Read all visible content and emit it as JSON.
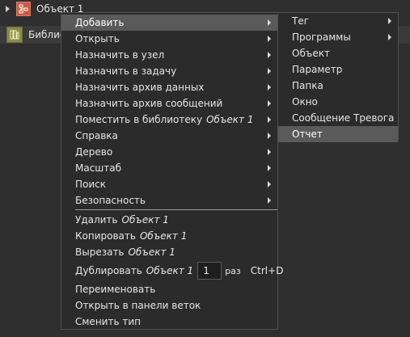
{
  "tree": {
    "object_label": "Объект 1",
    "library_label": "Библио"
  },
  "main_menu": {
    "items": [
      {
        "label": "Добавить"
      },
      {
        "label": "Открыть"
      },
      {
        "label": "Назначить в узел"
      },
      {
        "label": "Назначить в задачу"
      },
      {
        "label": "Назначить архив данных"
      },
      {
        "label": "Назначить архив сообщений"
      },
      {
        "label": "Поместить в библиотеку",
        "target": "Объект 1"
      },
      {
        "label": "Справка"
      },
      {
        "label": "Дерево"
      },
      {
        "label": "Масштаб"
      },
      {
        "label": "Поиск"
      },
      {
        "label": "Безопасность"
      }
    ],
    "actions": [
      {
        "label": "Удалить",
        "target": "Объект 1"
      },
      {
        "label": "Копировать",
        "target": "Объект 1"
      },
      {
        "label": "Вырезать",
        "target": "Объект 1"
      }
    ],
    "duplicate": {
      "label": "Дублировать",
      "target": "Объект 1",
      "value": "1",
      "unit": "раз",
      "shortcut": "Ctrl+D"
    },
    "tail": [
      {
        "label": "Переименовать"
      },
      {
        "label": "Открыть в панели веток"
      },
      {
        "label": "Сменить тип"
      }
    ]
  },
  "add_submenu": {
    "items": [
      {
        "label": "Тег"
      },
      {
        "label": "Программы"
      },
      {
        "label": "Объект"
      },
      {
        "label": "Параметр"
      },
      {
        "label": "Папка"
      },
      {
        "label": "Окно"
      },
      {
        "label": "Сообщение Тревога"
      },
      {
        "label": "Отчет"
      }
    ]
  }
}
